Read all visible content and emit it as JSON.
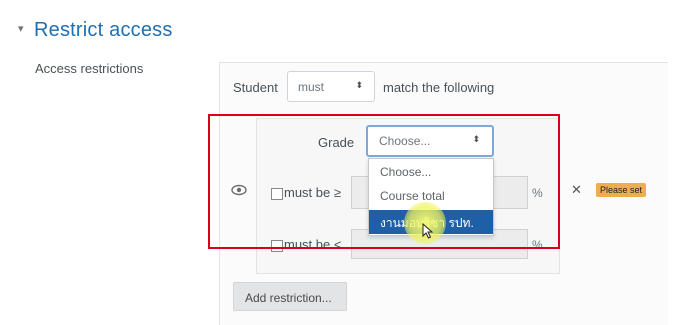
{
  "section": {
    "toggle_glyph": "▾",
    "title": "Restrict access"
  },
  "access_restrictions_label": "Access restrictions",
  "match_row": {
    "student_label": "Student",
    "must_value": "must",
    "match_label": "match the following"
  },
  "condition": {
    "grade_label": "Grade",
    "grade_select_value": "Choose...",
    "min_label": "must be ≥",
    "max_label": "must be <",
    "percent_symbol": "%",
    "delete_glyph": "✕",
    "please_set_badge": "Please set"
  },
  "grade_dropdown": {
    "options": [
      "Choose...",
      "Course total",
      "งานมอบวิชา รปท."
    ],
    "selected_index": 2
  },
  "add_restriction_label": "Add restriction...",
  "icons": {
    "select_arrow": "⬍",
    "eye": "eye-icon",
    "delete": "close-icon"
  },
  "colors": {
    "section_title": "#1f6fb2",
    "annotation_red": "#d9001b",
    "selected_option": "#1e5fa8",
    "badge": "#f0ad4e"
  }
}
